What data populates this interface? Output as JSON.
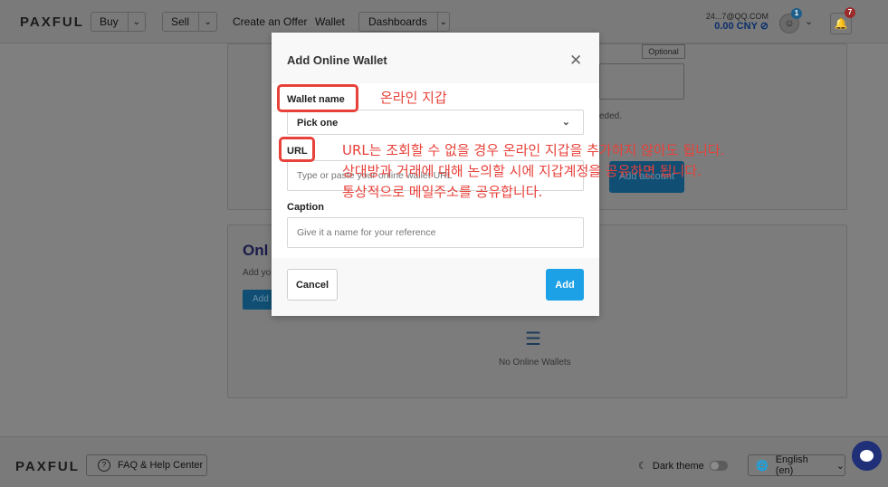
{
  "navbar": {
    "logo": "PAXFUL",
    "buy": "Buy",
    "sell": "Sell",
    "create_offer": "Create an Offer",
    "wallet": "Wallet",
    "dashboards": "Dashboards",
    "account_email": "24...7@QQ.COM",
    "balance": "0.00 CNY",
    "profile_badge": "1",
    "notification_badge": "7"
  },
  "background": {
    "optional_tag": "Optional",
    "helper_suffix": "eded.",
    "add_account_button": "Add account",
    "online_heading": "Onl",
    "online_sub": "Add yo",
    "add_button": "Add",
    "empty_text": "No Online Wallets"
  },
  "modal": {
    "title": "Add Online Wallet",
    "wallet_name_label": "Wallet name",
    "wallet_name_value": "Pick one",
    "url_label": "URL",
    "url_placeholder": "Type or paste your online wallet URL",
    "caption_label": "Caption",
    "caption_placeholder": "Give it a name for your reference",
    "cancel": "Cancel",
    "add": "Add"
  },
  "annotations": {
    "wallet_note": "온라인 지갑",
    "url_note_1": "URL는 조회할 수 없을 경우 온라인 지갑을 추가하지 않아도 됩니다.",
    "url_note_2": "상대방과 거래에 대해 논의할 시에 지갑계정을 공유하면 됩니다.",
    "url_note_3": "통상적으로 메일주소를 공유합니다."
  },
  "footer": {
    "logo": "PAXFUL",
    "faq": "FAQ & Help Center",
    "dark_theme": "Dark theme",
    "language": "English (en)"
  },
  "colors": {
    "accent": "#1da1e6",
    "annotation": "#e8413a",
    "brand_navy": "#1f2f78"
  }
}
